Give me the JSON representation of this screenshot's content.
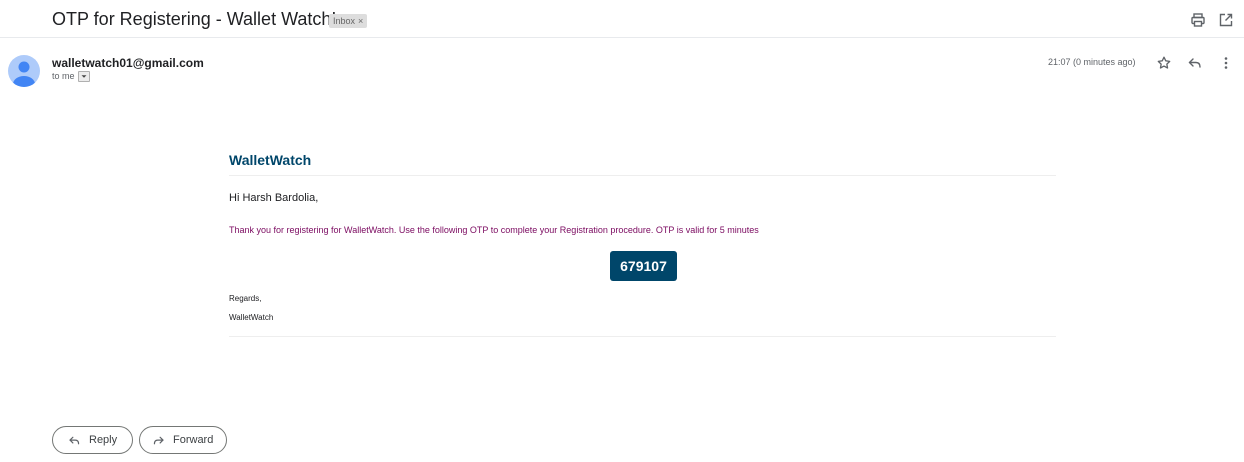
{
  "subject": "OTP for Registering - Wallet Watch!",
  "label": {
    "text": "Inbox",
    "remove": "×"
  },
  "sender": {
    "email": "walletwatch01@gmail.com",
    "recipient": "to me"
  },
  "timestamp": "21:07 (0 minutes ago)",
  "icons": [
    "print-icon",
    "open-in-new-window-icon",
    "avatar-icon",
    "dropdown-arrow-icon",
    "star-icon",
    "reply-icon",
    "more-vertical-icon",
    "forward-icon"
  ],
  "email": {
    "brand": "WalletWatch",
    "greeting": "Hi Harsh Bardolia,",
    "message": "Thank you for registering for WalletWatch. Use the following OTP to complete your Registration procedure. OTP is valid for 5 minutes",
    "otp": "679107",
    "regards": "Regards,",
    "signature": "WalletWatch"
  },
  "actions": {
    "reply": "Reply",
    "forward": "Forward"
  },
  "colors": {
    "brand": "#00466a",
    "message_text": "#7b0a60",
    "avatar": "#aecbfa",
    "avatar_figure": "#4285f4"
  }
}
